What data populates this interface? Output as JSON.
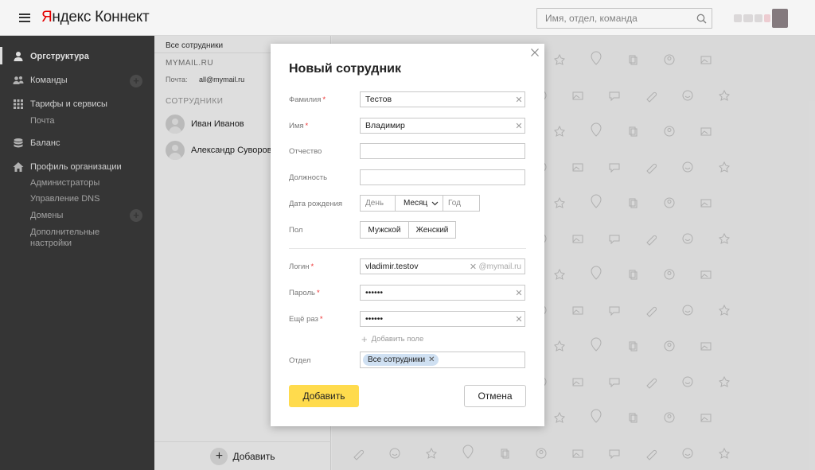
{
  "header": {
    "logo_brand_first": "Я",
    "logo_brand_rest": "ндекс",
    "logo_product": "Коннект",
    "search_placeholder": "Имя, отдел, команда"
  },
  "sidebar": {
    "items": [
      {
        "label": "Оргструктура",
        "icon": "user-icon",
        "active": true
      },
      {
        "label": "Команды",
        "icon": "team-icon"
      },
      {
        "label": "Тарифы и сервисы",
        "icon": "grid-icon"
      },
      {
        "label": "Баланс",
        "icon": "database-icon"
      },
      {
        "label": "Профиль организации",
        "icon": "home-icon"
      }
    ],
    "services_sub": [
      "Почта"
    ],
    "profile_sub": [
      "Администраторы",
      "Управление DNS",
      "Домены",
      "Дополнительные настройки"
    ]
  },
  "middle": {
    "breadcrumb": "Все сотрудники",
    "domain": "MYMAIL.RU",
    "mail_label": "Почта:",
    "mail_value": "all@mymail.ru",
    "section": "СОТРУДНИКИ",
    "employees": [
      "Иван Иванов",
      "Александр Суворов"
    ],
    "add_label": "Добавить"
  },
  "modal": {
    "title": "Новый сотрудник",
    "fields": {
      "last_name": {
        "label": "Фамилия",
        "value": "Тестов",
        "required": true
      },
      "first_name": {
        "label": "Имя",
        "value": "Владимир",
        "required": true
      },
      "middle_name": {
        "label": "Отчество",
        "value": ""
      },
      "position": {
        "label": "Должность",
        "value": ""
      },
      "birth_date": {
        "label": "Дата рождения",
        "day_placeholder": "День",
        "month_value": "Месяц",
        "year_placeholder": "Год"
      },
      "gender": {
        "label": "Пол",
        "options": [
          "Мужской",
          "Женский"
        ]
      },
      "login": {
        "label": "Логин",
        "value": "vladimir.testov",
        "suffix": "@mymail.ru",
        "required": true
      },
      "password": {
        "label": "Пароль",
        "value": "••••••",
        "required": true
      },
      "password_repeat": {
        "label": "Ещё раз",
        "value": "••••••",
        "required": true
      },
      "department": {
        "label": "Отдел",
        "chip": "Все сотрудники"
      }
    },
    "add_field_label": "Добавить поле",
    "submit_label": "Добавить",
    "cancel_label": "Отмена"
  },
  "colors": {
    "accent": "#ffdb4d",
    "sidebar_bg": "#3d3d3d",
    "required": "#ee3333",
    "chip_bg": "#cfe0f2"
  }
}
